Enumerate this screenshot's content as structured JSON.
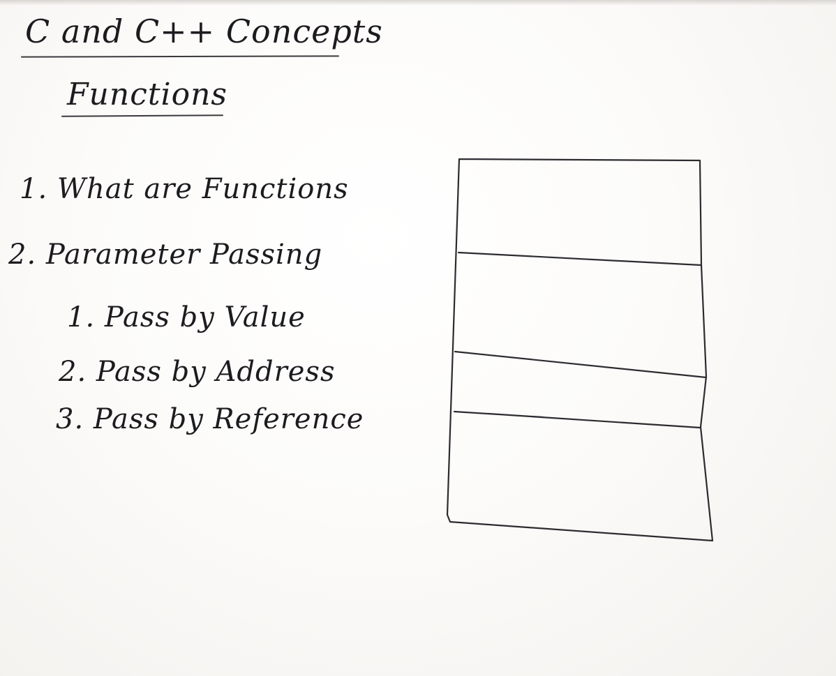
{
  "board": {
    "title": "C and C++ Concepts",
    "subtitle": "Functions",
    "items": [
      "1. What are Functions",
      "2. Parameter Passing"
    ],
    "subitems": [
      "1. Pass by Value",
      "2. Pass by Address",
      "3. Pass by Reference"
    ],
    "ink_color": "#1c1b1f"
  }
}
